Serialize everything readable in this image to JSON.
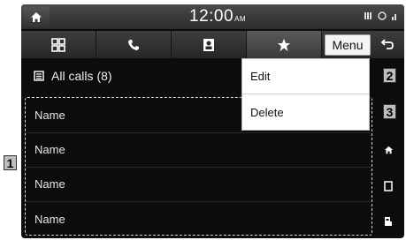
{
  "status_bar": {
    "time": "12:00",
    "ampm": "AM"
  },
  "tabs": [
    {
      "icon": "grid-icon"
    },
    {
      "icon": "phone-icon"
    },
    {
      "icon": "contacts-icon"
    },
    {
      "icon": "star-icon",
      "active": true
    }
  ],
  "toolbar": {
    "menu_label": "Menu",
    "back_icon": "back-arrow-icon"
  },
  "list_header": {
    "icon": "list-icon",
    "label": "All calls",
    "count": "(8)"
  },
  "rows": [
    {
      "label": "Name"
    },
    {
      "label": "Name"
    },
    {
      "label": "Name"
    },
    {
      "label": "Name"
    }
  ],
  "popup_menu": {
    "items": [
      {
        "label": "Edit"
      },
      {
        "label": "Delete"
      }
    ]
  },
  "callouts": {
    "list": "1",
    "edit": "2",
    "delete": "3"
  }
}
